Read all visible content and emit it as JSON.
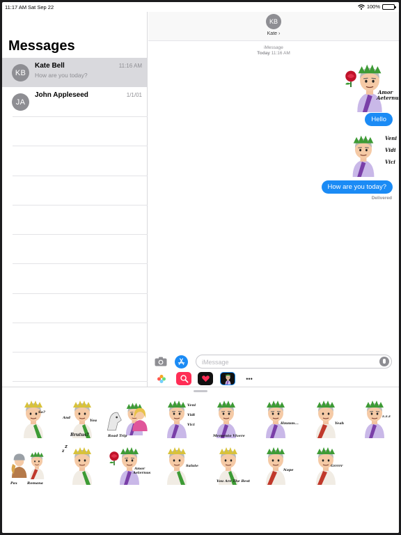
{
  "status_bar": {
    "time": "11:17 AM",
    "date": "Sat Sep 22",
    "battery": "100%",
    "battery_level": 1.0
  },
  "sidebar": {
    "title": "Messages",
    "conversations": [
      {
        "initials": "KB",
        "name": "Kate Bell",
        "preview": "How are you today?",
        "time": "11:16 AM",
        "selected": true
      },
      {
        "initials": "JA",
        "name": "John Appleseed",
        "preview": "",
        "time": "1/1/01",
        "selected": false
      }
    ]
  },
  "conversation": {
    "contact_initials": "KB",
    "contact_name": "Kate",
    "service": "iMessage",
    "timestamp_day": "Today",
    "timestamp_time": "11:16 AM",
    "messages": [
      {
        "kind": "sticker",
        "words": [
          "Amor",
          "Aeternus"
        ]
      },
      {
        "kind": "text",
        "text": "Hello"
      },
      {
        "kind": "sticker",
        "words": [
          "Veni",
          "Vidi",
          "Vici"
        ]
      },
      {
        "kind": "text",
        "text": "How are you today?"
      }
    ],
    "status": "Delivered"
  },
  "composer": {
    "placeholder": "iMessage",
    "icons": [
      "camera-icon",
      "app-store-icon",
      "photos-icon",
      "search-images-icon",
      "digital-touch-icon",
      "sticker-pack-icon",
      "more-apps-icon"
    ],
    "more_label": "•••"
  },
  "sticker_tray": {
    "stickers": [
      {
        "label": "So?",
        "words": [
          "So?"
        ]
      },
      {
        "label": "And Brutus?",
        "words": [
          "And",
          "You",
          "Brutus?"
        ]
      },
      {
        "label": "Road Trip",
        "words": [
          "Road Trip"
        ]
      },
      {
        "label": "Veni Vidi Vici",
        "words": [
          "Veni",
          "Vidi",
          "Vici"
        ]
      },
      {
        "label": "Memento Vivere",
        "words": [
          "Memento Vivere"
        ]
      },
      {
        "label": "Hmmm...",
        "words": [
          "Hmmm..."
        ]
      },
      {
        "label": "Yeah",
        "words": [
          "Yeah"
        ]
      },
      {
        "label": "Z.Z.Z",
        "words": [
          "z.z.z"
        ]
      },
      {
        "label": "Pax Romana",
        "words": [
          "Pax",
          "Romana"
        ]
      },
      {
        "label": "Sleepy",
        "words": [
          "z",
          "z"
        ]
      },
      {
        "label": "Amor Aeternus",
        "words": [
          "Amor",
          "Aeternus"
        ]
      },
      {
        "label": "Salute",
        "words": [
          "Salute"
        ]
      },
      {
        "label": "You Are The Best",
        "words": [
          "You Are The Best"
        ]
      },
      {
        "label": "Nope",
        "words": [
          "Nope"
        ]
      },
      {
        "label": "Grrrrr",
        "words": [
          "Grrrrr"
        ]
      }
    ]
  },
  "colors": {
    "imessage_blue": "#1b8bf5",
    "laurel_green": "#3d9b35",
    "toga_purple": "#8a4fb0",
    "selection_gray": "#d9d9dd"
  }
}
